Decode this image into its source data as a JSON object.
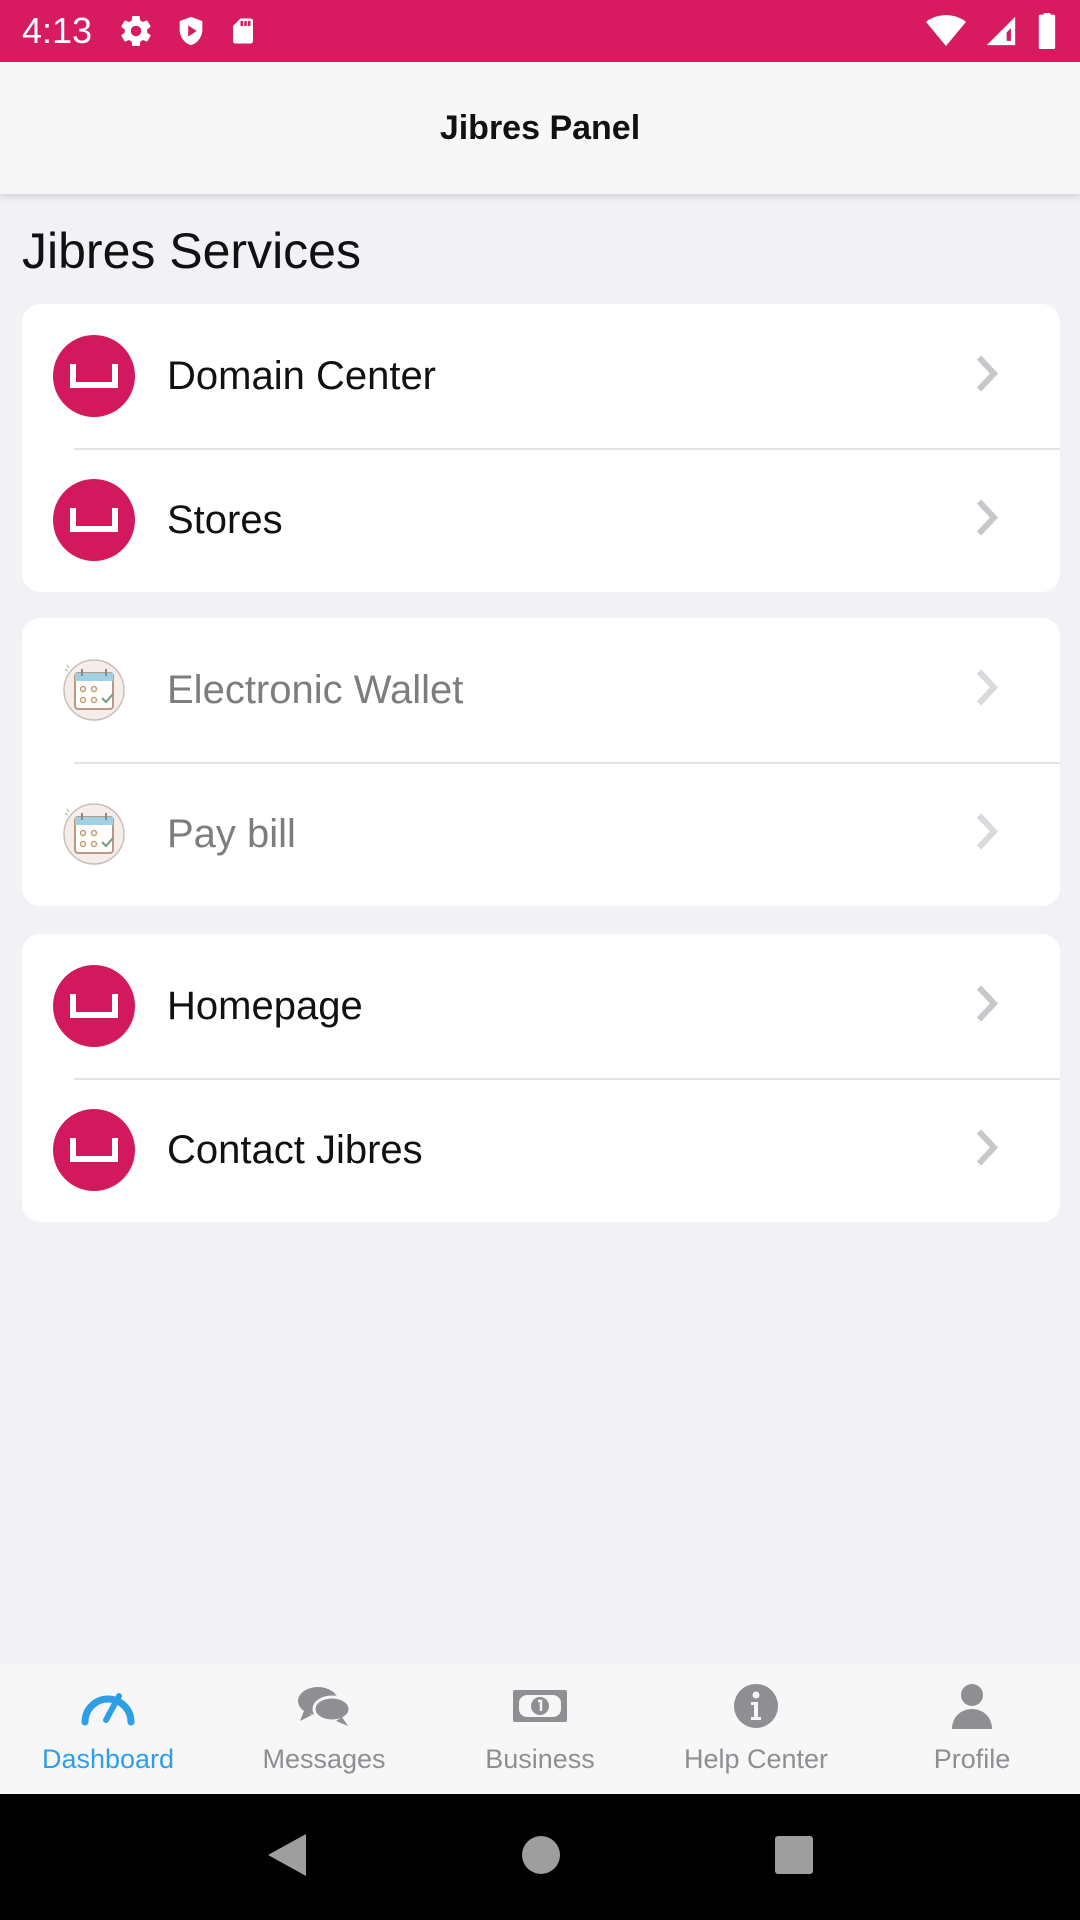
{
  "status_bar": {
    "time": "4:13",
    "icons_left": [
      "gear-icon",
      "shield-play-icon",
      "sd-card-icon"
    ],
    "icons_right": [
      "wifi-icon",
      "cell-signal-icon",
      "battery-icon"
    ],
    "color": "#d81b60"
  },
  "header": {
    "title": "Jibres Panel"
  },
  "section_title": "Jibres Services",
  "groups": [
    {
      "items": [
        {
          "label": "Domain Center",
          "icon": "box-icon",
          "enabled": true
        },
        {
          "label": "Stores",
          "icon": "box-icon",
          "enabled": true
        }
      ]
    },
    {
      "items": [
        {
          "label": "Electronic Wallet",
          "icon": "calendar-icon",
          "enabled": false
        },
        {
          "label": "Pay bill",
          "icon": "calendar-icon",
          "enabled": false
        }
      ]
    },
    {
      "items": [
        {
          "label": "Homepage",
          "icon": "box-icon",
          "enabled": true
        },
        {
          "label": "Contact Jibres",
          "icon": "box-icon",
          "enabled": true
        }
      ]
    }
  ],
  "tabs": [
    {
      "label": "Dashboard",
      "icon": "speedometer-icon",
      "active": true
    },
    {
      "label": "Messages",
      "icon": "chat-bubbles-icon",
      "active": false
    },
    {
      "label": "Business",
      "icon": "money-bill-icon",
      "active": false
    },
    {
      "label": "Help Center",
      "icon": "info-icon",
      "active": false
    },
    {
      "label": "Profile",
      "icon": "user-icon",
      "active": false
    }
  ],
  "colors": {
    "accent": "#d3195d",
    "active_tab": "#2e9fe6",
    "inactive_tab": "#8e8e93"
  }
}
